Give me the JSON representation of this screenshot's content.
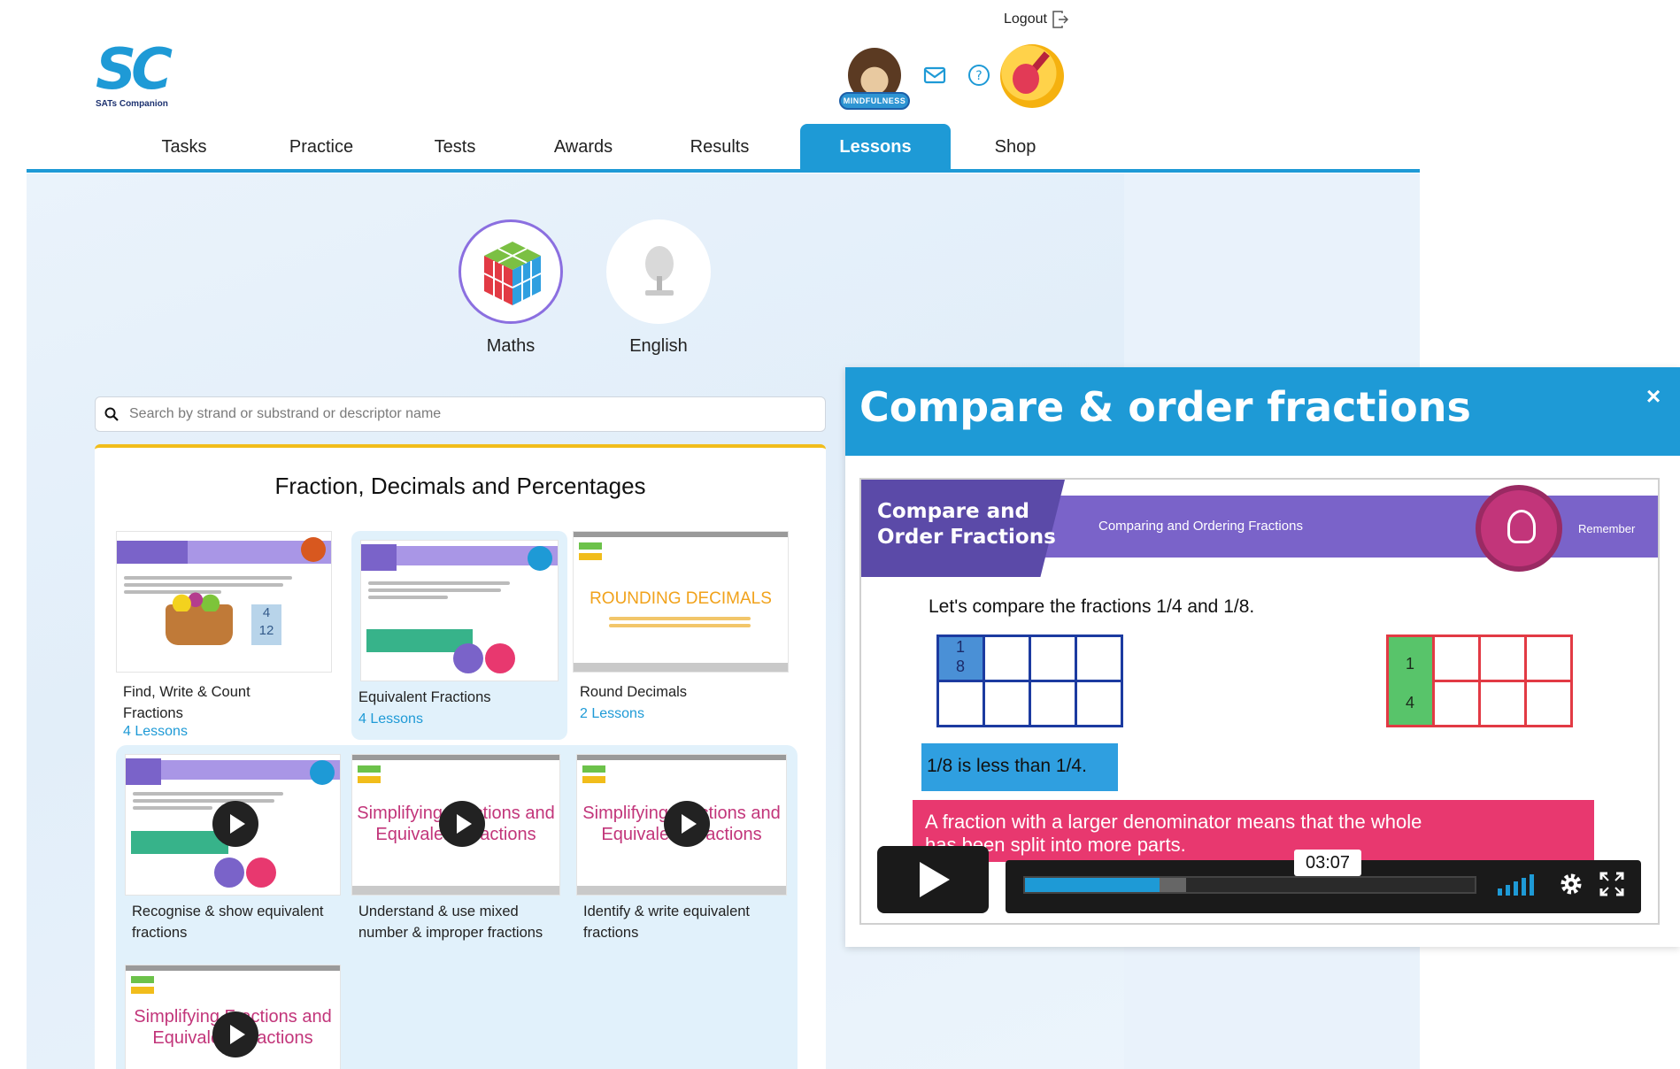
{
  "header": {
    "logo_text": "SC",
    "logo_sub": "SATs Companion",
    "logout_label": "Logout",
    "avatar_badge": "MINDFULNESS"
  },
  "nav": {
    "tabs": [
      {
        "label": "Tasks",
        "active": false
      },
      {
        "label": "Practice",
        "active": false
      },
      {
        "label": "Tests",
        "active": false
      },
      {
        "label": "Awards",
        "active": false
      },
      {
        "label": "Results",
        "active": false
      },
      {
        "label": "Lessons",
        "active": true
      },
      {
        "label": "Shop",
        "active": false
      }
    ]
  },
  "subjects": [
    {
      "label": "Maths",
      "selected": true
    },
    {
      "label": "English",
      "selected": false
    }
  ],
  "search": {
    "placeholder": "Search by strand or substrand or descriptor name"
  },
  "section": {
    "title": "Fraction, Decimals and Percentages",
    "cards": [
      {
        "title_line1": "Find, Write & Count",
        "title_line2": "Fractions",
        "count": "4 Lessons",
        "thumb_heading": "",
        "video": false
      },
      {
        "title_line1": "Equivalent Fractions",
        "title_line2": "",
        "count": "4 Lessons",
        "thumb_heading": "",
        "video": false
      },
      {
        "title_line1": "Round Decimals",
        "title_line2": "",
        "count": "2 Lessons",
        "thumb_heading": "ROUNDING DECIMALS",
        "video": false
      },
      {
        "title_line1": "Recognise & show equivalent",
        "title_line2": "fractions",
        "count": "",
        "thumb_heading": "",
        "video": true
      },
      {
        "title_line1": "Understand & use mixed",
        "title_line2": "number & improper fractions",
        "count": "",
        "thumb_heading": "Simplifying Fractions and Equivalent Fractions",
        "video": true
      },
      {
        "title_line1": "Identify & write equivalent",
        "title_line2": "fractions",
        "count": "",
        "thumb_heading": "Simplifying Fractions and Equivalent Fractions",
        "video": true
      },
      {
        "title_line1": "",
        "title_line2": "",
        "count": "",
        "thumb_heading": "Simplifying Fractions and Equivalent Fractions",
        "video": true
      }
    ]
  },
  "modal": {
    "title": "Compare & order fractions",
    "close_label": "×",
    "video": {
      "slide_title_line1": "Compare and",
      "slide_title_line2": "Order Fractions",
      "slide_subtitle": "Comparing and Ordering Fractions",
      "slide_tag": "Remember",
      "prompt": "Let's compare the fractions 1/4 and 1/8.",
      "left_numerator": "1",
      "left_denominator": "8",
      "right_numerator": "1",
      "right_denominator": "4",
      "statement": "1/8 is less than 1/4.",
      "explanation_line1": "A fraction with a larger denominator means that the whole",
      "explanation_line2": "has been split into more parts.",
      "timestamp": "03:07",
      "played_fraction": 0.3,
      "buffered_fraction": 0.36
    }
  },
  "colors": {
    "accent": "#1e9ad6",
    "section_border": "#f1bd1b",
    "selected_ring": "#8b6fe0",
    "pink": "#e8386f",
    "purple": "#7a63c9"
  }
}
